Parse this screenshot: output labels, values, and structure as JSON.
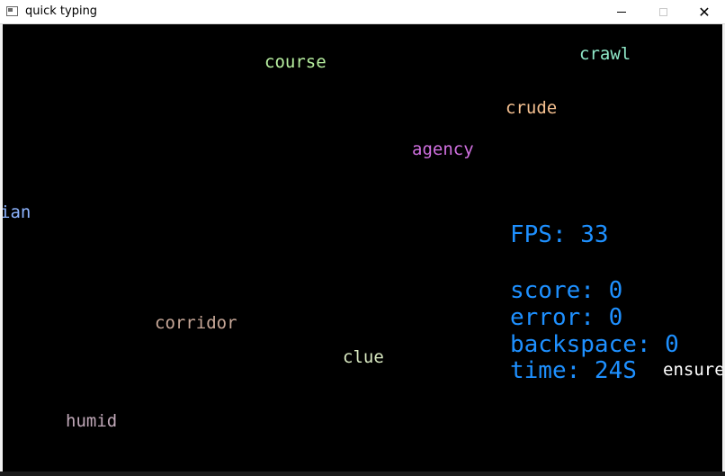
{
  "window": {
    "title": "quick typing",
    "minimize_icon": "minimize-icon",
    "maximize_icon": "maximize-icon",
    "close_icon": "close-icon",
    "close_glyph": "✕"
  },
  "falling_words": [
    {
      "text": "course",
      "color": "#b8f0a0"
    },
    {
      "text": "crawl",
      "color": "#8fe8c8"
    },
    {
      "text": "crude",
      "color": "#f5c090"
    },
    {
      "text": "agency",
      "color": "#d070e0"
    },
    {
      "text": "ian",
      "color": "#8db4ff"
    },
    {
      "text": "corridor",
      "color": "#c8a898"
    },
    {
      "text": "clue",
      "color": "#d8e8c0"
    },
    {
      "text": "humid",
      "color": "#c0a8b8"
    },
    {
      "text": "ensure",
      "color": "#ffffff"
    }
  ],
  "hud": {
    "fps": "FPS: 33",
    "score": "score: 0",
    "error": "error: 0",
    "backspace": "backspace: 0",
    "time": "time: 24S",
    "color": "#1e90ff"
  }
}
